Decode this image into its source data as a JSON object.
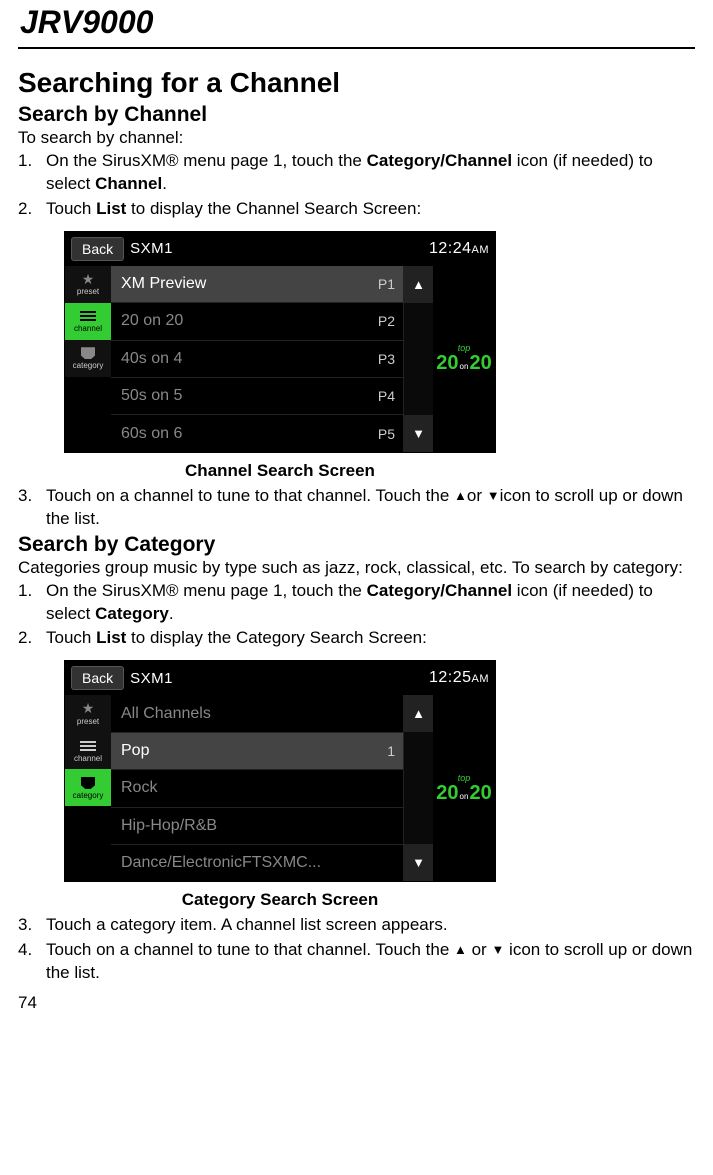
{
  "model": "JRV9000",
  "page_number": "74",
  "h2": "Searching for a Channel",
  "channel": {
    "h3": "Search by Channel",
    "intro": "To search by channel:",
    "step1_a": "On the SirusXM® menu page 1, touch the ",
    "step1_b": "Category/Channel",
    "step1_c": " icon (if needed) to select ",
    "step1_d": "Channel",
    "step1_e": ".",
    "step2_a": "Touch ",
    "step2_b": "List",
    "step2_c": " to display the Channel Search Screen:",
    "caption": "Channel Search Screen",
    "step3_a": "Touch on a channel to tune to that channel. Touch the ",
    "step3_b": "or ",
    "step3_c": "icon to scroll up or down the list.",
    "screen": {
      "back": "Back",
      "source": "SXM1",
      "time": "12:24",
      "ampm": "AM",
      "side": {
        "preset": "preset",
        "channel": "channel",
        "category": "category"
      },
      "rows": [
        {
          "name": "XM Preview",
          "p": "P1",
          "hl": true
        },
        {
          "name": "20 on 20",
          "p": "P2"
        },
        {
          "name": "40s on 4",
          "p": "P3"
        },
        {
          "name": "50s on 5",
          "p": "P4"
        },
        {
          "name": "60s on 6",
          "p": "P5"
        }
      ]
    }
  },
  "category": {
    "h3": "Search by Category",
    "intro": "Categories group music by type such as  jazz, rock, classical, etc. To search by category:",
    "step1_a": "On the SirusXM® menu page 1, touch the ",
    "step1_b": "Category/Channel",
    "step1_c": " icon (if needed) to select ",
    "step1_d": "Category",
    "step1_e": ".",
    "step2_a": "Touch ",
    "step2_b": "List",
    "step2_c": " to display the Category Search Screen:",
    "caption": "Category Search Screen",
    "step3": "Touch a category item. A channel list screen appears.",
    "step4_a": "Touch on a channel to tune to that channel. Touch the ",
    "step4_b": " or ",
    "step4_c": " icon to scroll up or down the list.",
    "screen": {
      "back": "Back",
      "source": "SXM1",
      "time": "12:25",
      "ampm": "AM",
      "side": {
        "preset": "preset",
        "channel": "channel",
        "category": "category"
      },
      "rows": [
        {
          "name": "All Channels",
          "p": ""
        },
        {
          "name": "Pop",
          "p": "1",
          "hl": true
        },
        {
          "name": "Rock",
          "p": ""
        },
        {
          "name": "Hip-Hop/R&B",
          "p": ""
        },
        {
          "name": "Dance/ElectronicFTSXMC...",
          "p": ""
        }
      ]
    }
  },
  "art": {
    "top": "top",
    "twenty": "20",
    "on": "on"
  }
}
